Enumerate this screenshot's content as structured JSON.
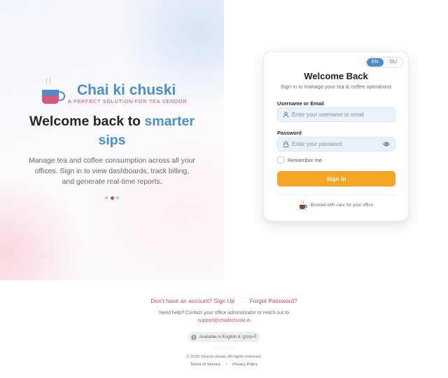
{
  "brand": {
    "name": "Chai ki chuski",
    "tagline": "A PERFECT SOLUTION FOR TEA VENDOR",
    "logo_icon": "tea-cup-icon"
  },
  "hero": {
    "title_part1": "Welcome back to",
    "title_accent": "smarter sips",
    "description": "Manage tea and coffee consumption across all your offices. Sign in to view dashboards, track billing, and generate real-time reports.",
    "carousel_total": 3,
    "carousel_active": 2
  },
  "login": {
    "languages": [
      "EN",
      "GU"
    ],
    "active_language": "EN",
    "title": "Welcome Back",
    "subtitle": "Sign in to manage your tea & coffee operations",
    "username_label": "Username or Email",
    "username_placeholder": "Enter your username or email",
    "password_label": "Password",
    "password_placeholder": "Enter your password",
    "remember_label": "Remember me",
    "submit_label": "Sign In",
    "brew_note": "Brewed with care for your office"
  },
  "footer": {
    "signup_link": "Don't have an account? Sign Up",
    "separator": "·",
    "forgot_link": "Forgot Password?",
    "help_text": "Need help? Contact your office administrator or reach out to",
    "support_email": "support@chaikichuski.in",
    "availability": "Available in English & ગુજરાતી",
    "copyright": "© 2026 Chai ki chuski. All rights reserved.",
    "terms": "Terms of Service",
    "legal_sep": "•",
    "privacy": "Privacy Policy"
  },
  "colors": {
    "accent_blue": "#4a8ed0",
    "accent_pink": "#d6466a",
    "button_orange": "#f4a523",
    "field_bg": "#e9f1fb"
  }
}
